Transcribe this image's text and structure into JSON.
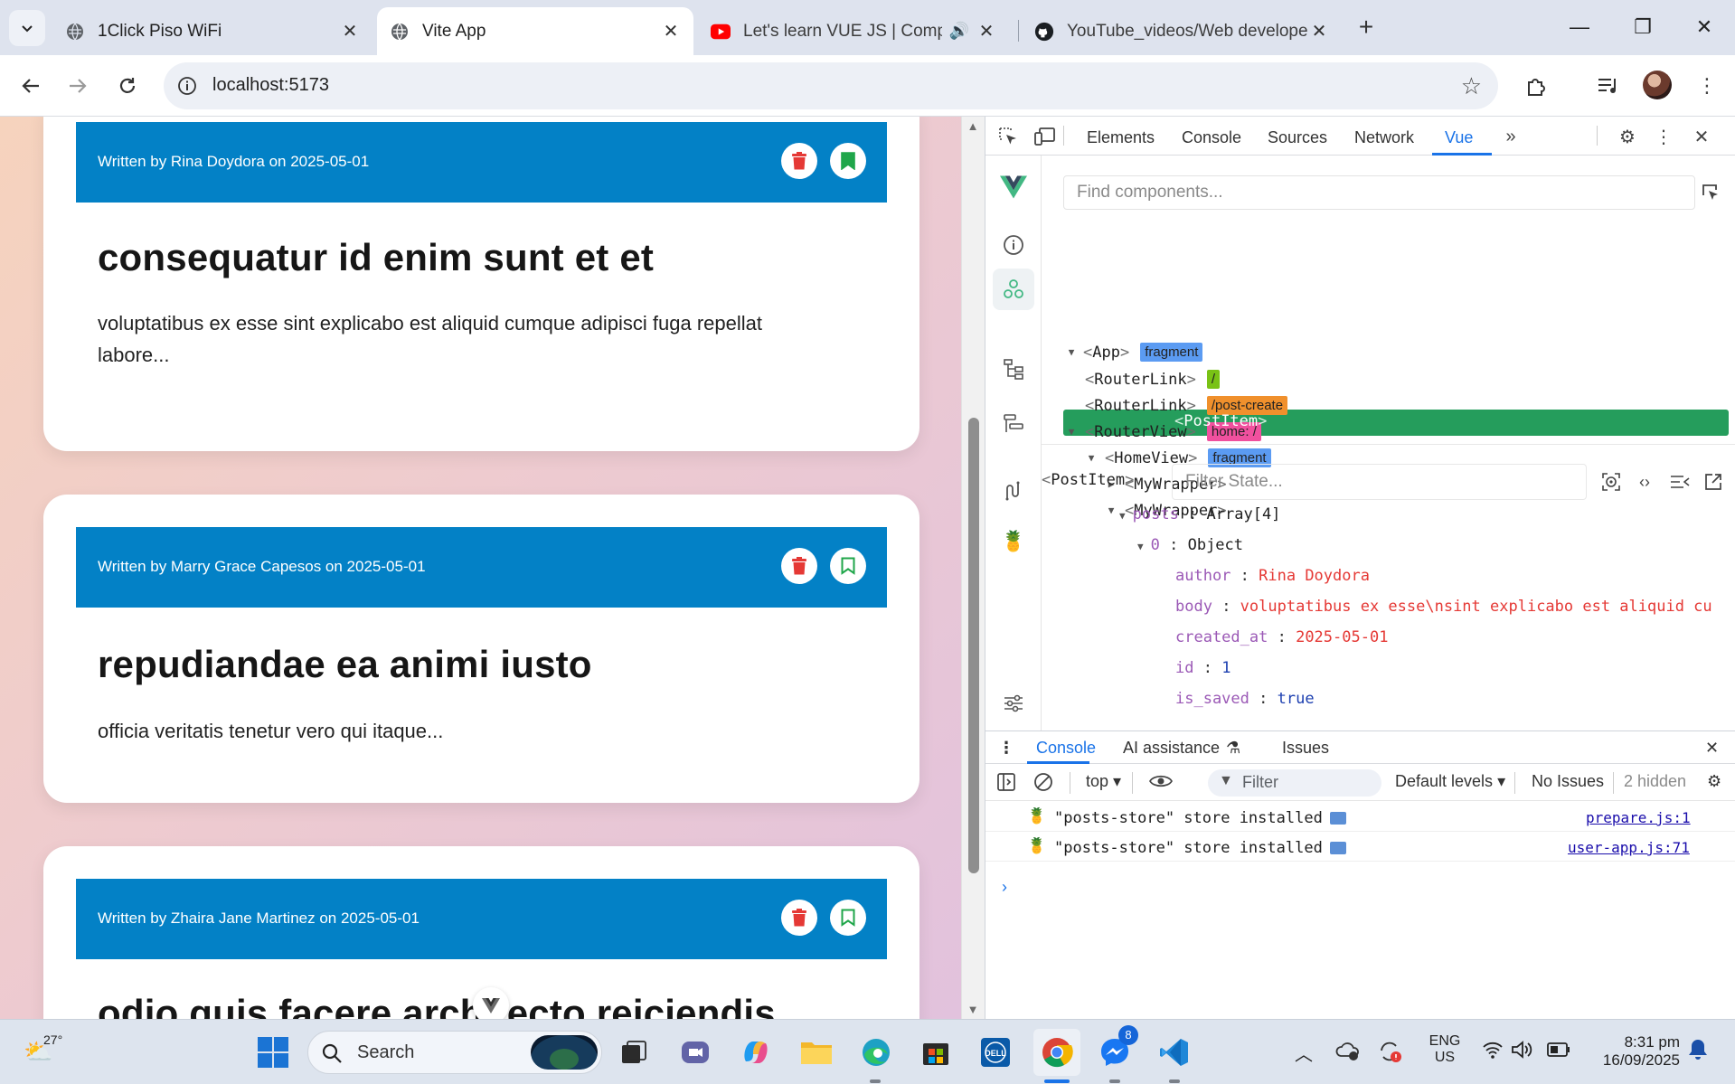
{
  "browser": {
    "tabs": [
      {
        "title": "1Click Piso WiFi",
        "icon": "globe-icon"
      },
      {
        "title": "Vite App",
        "icon": "globe-icon",
        "active": true
      },
      {
        "title": "Let's learn VUE JS | Compos",
        "icon": "youtube-icon",
        "audio": true
      },
      {
        "title": "YouTube_videos/Web develope",
        "icon": "github-icon"
      }
    ],
    "url": "localhost:5173"
  },
  "page": {
    "posts": [
      {
        "meta": "Written by Rina Doydora on 2025-05-01",
        "title": "consequatur id enim sunt et et",
        "body": "voluptatibus ex esse sint explicabo est aliquid cumque adipisci fuga repellat labore...",
        "saved": true
      },
      {
        "meta": "Written by Marry Grace Capesos on 2025-05-01",
        "title": "repudiandae ea animi iusto",
        "body": "officia veritatis tenetur vero qui itaque...",
        "saved": false
      },
      {
        "meta": "Written by Zhaira Jane Martinez on 2025-05-01",
        "title": "odio quis facere architecto reiciendis",
        "body": "",
        "saved": false
      }
    ],
    "colors": {
      "header": "#0381c6",
      "delete": "#e53935",
      "save": "#1fa64a"
    }
  },
  "devtools": {
    "tabs": [
      "Elements",
      "Console",
      "Sources",
      "Network",
      "Vue"
    ],
    "active_tab": "Vue",
    "find_placeholder": "Find components...",
    "tree": [
      {
        "name": "App",
        "badge": "fragment",
        "badge_color": "#5b9bf2"
      },
      {
        "name": "RouterLink",
        "badge": "/",
        "badge_color": "#79c215"
      },
      {
        "name": "RouterLink",
        "badge": "/post-create",
        "badge_color": "#f0902c"
      },
      {
        "name": "RouterView",
        "badge": "home: /",
        "badge_color": "#f0509e"
      },
      {
        "name": "HomeView",
        "badge": "fragment",
        "badge_color": "#5b9bf2"
      },
      {
        "name": "MyWrapper",
        "badge": ""
      },
      {
        "name": "MyWrapper",
        "badge": ""
      },
      {
        "name": "PostItem",
        "badge": ""
      }
    ],
    "selected_component": "PostItem",
    "filter_state_placeholder": "Filter State...",
    "state": {
      "posts_key": "posts",
      "posts_val": "Array[4]",
      "idx_key": "0",
      "idx_val": "Object",
      "props": [
        {
          "key": "author",
          "value": "Rina Doydora",
          "kind": "str"
        },
        {
          "key": "body",
          "value": "voluptatibus ex esse\\nsint explicabo est aliquid cu",
          "kind": "str"
        },
        {
          "key": "created_at",
          "value": "2025-05-01",
          "kind": "str"
        },
        {
          "key": "id",
          "value": "1",
          "kind": "num"
        },
        {
          "key": "is_saved",
          "value": "true",
          "kind": "kw"
        }
      ]
    },
    "drawer_tabs": [
      "Console",
      "AI assistance",
      "Issues"
    ],
    "console_bar": {
      "context": "top",
      "filter": "Filter",
      "levels": "Default levels",
      "issues": "No Issues",
      "hidden": "2 hidden"
    },
    "logs": [
      {
        "message": "\"posts-store\" store installed",
        "source": "prepare.js:1"
      },
      {
        "message": "\"posts-store\" store installed",
        "source": "user-app.js:71"
      }
    ]
  },
  "taskbar": {
    "weather": "27°",
    "search_placeholder": "Search",
    "messenger_badge": "8",
    "lang_1": "ENG",
    "lang_2": "US",
    "time": "8:31 pm",
    "date": "16/09/2025"
  }
}
